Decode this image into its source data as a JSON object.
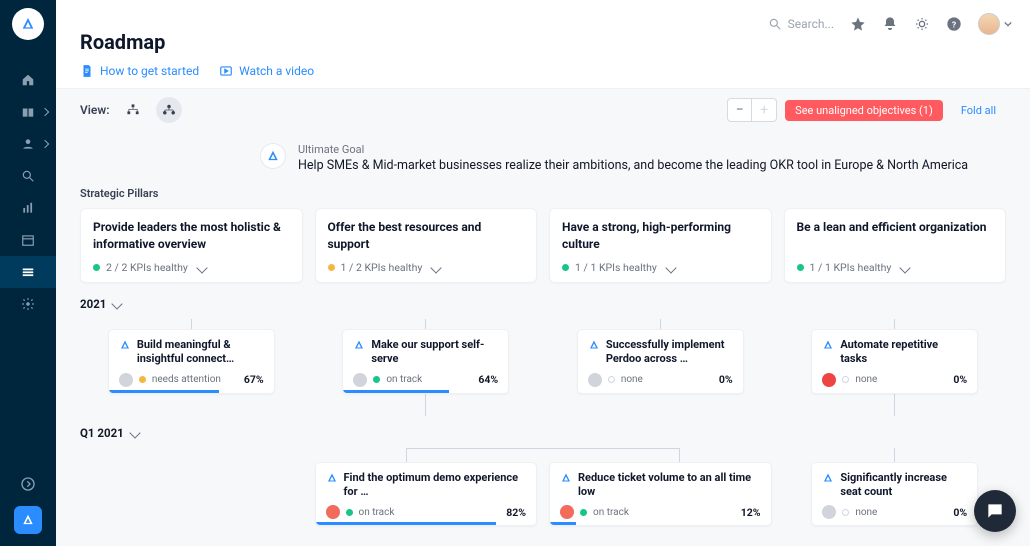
{
  "header": {
    "title": "Roadmap",
    "links": {
      "howto": "How to get started",
      "video": "Watch a video"
    },
    "search_placeholder": "Search..."
  },
  "toolbar": {
    "view_label": "View:",
    "unaligned": "See unaligned objectives (1)",
    "fold_all": "Fold all"
  },
  "goal": {
    "label": "Ultimate Goal",
    "text": "Help SMEs & Mid-market businesses realize their ambitions, and become the leading OKR tool in Europe & North America"
  },
  "pillars_label": "Strategic Pillars",
  "pillars": [
    {
      "title": "Provide leaders the most holistic & informative overview",
      "kpi": "2 / 2 KPIs healthy",
      "color": "green"
    },
    {
      "title": "Offer the best resources and support",
      "kpi": "1 / 2 KPIs healthy",
      "color": "amber"
    },
    {
      "title": "Have a strong, high-performing culture",
      "kpi": "1 / 1 KPIs healthy",
      "color": "green"
    },
    {
      "title": "Be a lean and efficient organization",
      "kpi": "1 / 1 KPIs healthy",
      "color": "green"
    }
  ],
  "year": "2021",
  "objectives_2021": [
    {
      "title": "Build meaningful & insightful connect…",
      "status": "needs attention",
      "status_color": "amber",
      "pct": "67%",
      "bar": 67
    },
    {
      "title": "Make our support self-serve",
      "status": "on track",
      "status_color": "green",
      "pct": "64%",
      "bar": 64
    },
    {
      "title": "Successfully implement Perdoo across …",
      "status": "none",
      "status_color": "none",
      "pct": "0%",
      "bar": 0
    },
    {
      "title": "Automate repetitive tasks",
      "status": "none",
      "status_color": "none",
      "pct": "0%",
      "bar": 0,
      "owner": "stop"
    }
  ],
  "quarter": "Q1 2021",
  "q1": {
    "support_children": [
      {
        "title": "Find the optimum demo experience for …",
        "status": "on track",
        "pct": "82%",
        "bar": 82,
        "owner": "red"
      },
      {
        "title": "Reduce ticket volume to an all time low",
        "status": "on track",
        "pct": "12%",
        "bar": 12,
        "owner": "red2"
      }
    ],
    "lean_child": {
      "title": "Significantly increase seat count",
      "status": "none",
      "pct": "0%",
      "bar": 0
    }
  }
}
